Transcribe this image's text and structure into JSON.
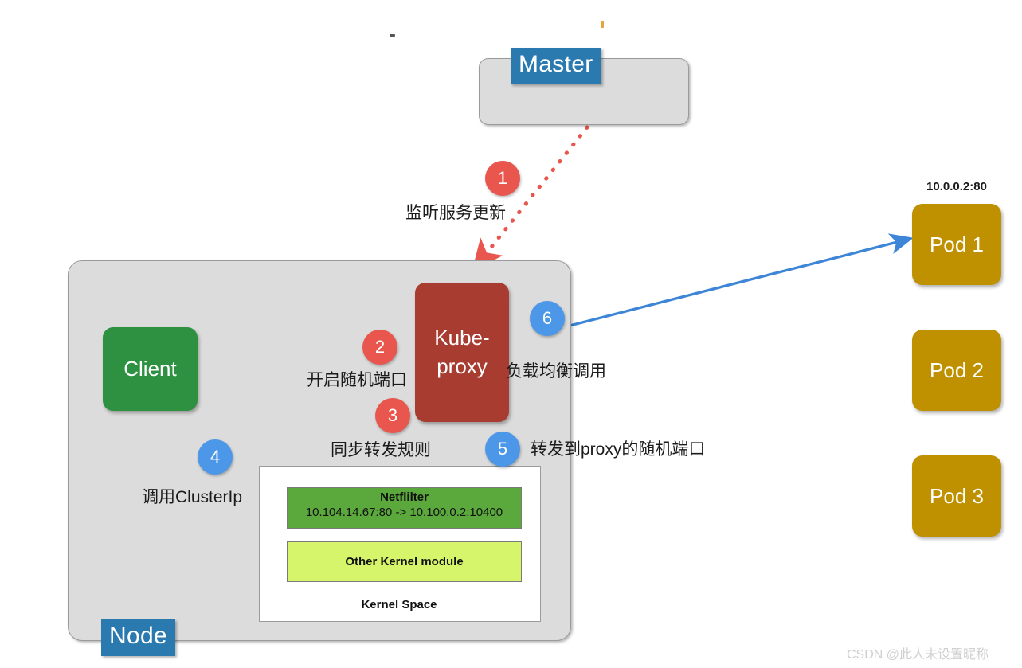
{
  "diagram": {
    "title_tags": {
      "master": "Master",
      "node": "Node"
    },
    "boxes": {
      "client": "Client",
      "kube_proxy": "Kube-\nproxy",
      "kube_proxy_line1": "Kube-",
      "kube_proxy_line2": "proxy"
    },
    "kernel": {
      "space_label": "Kernel Space",
      "netfilter_title": "Netflilter",
      "netfilter_rule": "10.104.14.67:80 -> 10.100.0.2:10400",
      "other_module": "Other Kernel module"
    },
    "pods": [
      {
        "label": "Pod 1",
        "ip": "10.0.0.2:80"
      },
      {
        "label": "Pod 2",
        "ip": ""
      },
      {
        "label": "Pod 3",
        "ip": ""
      }
    ],
    "steps": [
      {
        "number": "1",
        "caption": "监听服务更新",
        "color": "#e8564d"
      },
      {
        "number": "2",
        "caption": "开启随机端口",
        "color": "#e8564d"
      },
      {
        "number": "3",
        "caption": "同步转发规则",
        "color": "#e8564d"
      },
      {
        "number": "4",
        "caption": "调用ClusterIp",
        "color": "#4d97e8"
      },
      {
        "number": "5",
        "caption": "转发到proxy的随机端口",
        "color": "#4d97e8"
      },
      {
        "number": "6",
        "caption": "负载均衡调用",
        "color": "#4d97e8"
      }
    ],
    "colors": {
      "master_fill": "#dcdcdc",
      "node_fill": "#dcdcdc",
      "tag_blue": "#2a7ab0",
      "client_green": "#2e9142",
      "proxy_red": "#a83c30",
      "pod_gold": "#bf9000",
      "netfilter_green": "#5ba93c",
      "other_module_green": "#d7f56b",
      "step_red": "#e8564d",
      "step_blue": "#4d97e8",
      "arrow_blue": "#3d85d6",
      "arrow_red_dotted": "#e8564d",
      "watermark_gray": "#cfcfcf"
    },
    "watermark": "CSDN @此人未设置昵称"
  }
}
